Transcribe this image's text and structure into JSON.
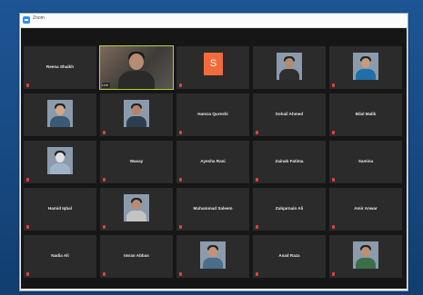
{
  "window": {
    "title": "Zoom"
  },
  "participants": [
    {
      "name": "Reena Shaikh",
      "type": "name",
      "muted": true
    },
    {
      "name": "Live",
      "type": "video",
      "muted": false,
      "active": true,
      "label": "Live"
    },
    {
      "name": "",
      "type": "initial",
      "initial": "S",
      "muted": true,
      "label": ""
    },
    {
      "name": "",
      "type": "photo",
      "muted": false,
      "label": "",
      "skin": "#b58b6e",
      "shirt": "#2f2f2f"
    },
    {
      "name": "",
      "type": "photo",
      "muted": true,
      "label": "",
      "skin": "#c79b7f",
      "shirt": "#1f6fa8"
    },
    {
      "name": "",
      "type": "photo",
      "muted": false,
      "label": "",
      "skin": "#d2a888",
      "shirt": "#3a5a78"
    },
    {
      "name": "",
      "type": "photo",
      "muted": true,
      "label": "",
      "skin": "#b48468",
      "shirt": "#2c3e50"
    },
    {
      "name": "Hamza Qureshi",
      "type": "name",
      "muted": true
    },
    {
      "name": "Sohail Ahmed",
      "type": "name",
      "muted": true
    },
    {
      "name": "Bilal Malik",
      "type": "name",
      "muted": true
    },
    {
      "name": "",
      "type": "photo",
      "muted": true,
      "label": "",
      "skin": "#e0e0e0",
      "shirt": "#9fb3c8"
    },
    {
      "name": "Wasay",
      "type": "name",
      "muted": true
    },
    {
      "name": "Ayesha Rani",
      "type": "name",
      "muted": true
    },
    {
      "name": "Zainab Fatima",
      "type": "name",
      "muted": true
    },
    {
      "name": "Samina",
      "type": "name",
      "muted": true
    },
    {
      "name": "Hamid Iqbal",
      "type": "name",
      "muted": true
    },
    {
      "name": "",
      "type": "photo",
      "muted": true,
      "label": "",
      "skin": "#b98c70",
      "shirt": "#c3c3c3"
    },
    {
      "name": "Muhammad Saleem",
      "type": "name",
      "muted": true
    },
    {
      "name": "Zulqarnain Ali",
      "type": "name",
      "muted": true
    },
    {
      "name": "Amir Anwar",
      "type": "name",
      "muted": true
    },
    {
      "name": "Nadia Ali",
      "type": "name",
      "muted": true
    },
    {
      "name": "Imran Abbas",
      "type": "name",
      "muted": true
    },
    {
      "name": "",
      "type": "photo",
      "muted": true,
      "label": "",
      "skin": "#c49376",
      "shirt": "#4a6d8c"
    },
    {
      "name": "Asad Raza",
      "type": "name",
      "muted": true
    },
    {
      "name": "",
      "type": "photo",
      "muted": true,
      "label": "",
      "skin": "#be8f71",
      "shirt": "#3c6e4a"
    }
  ],
  "colors": {
    "active_border": "#b7d531",
    "tile_bg": "#2b2b2b",
    "background": "#161616",
    "muted_icon": "#e34040"
  }
}
